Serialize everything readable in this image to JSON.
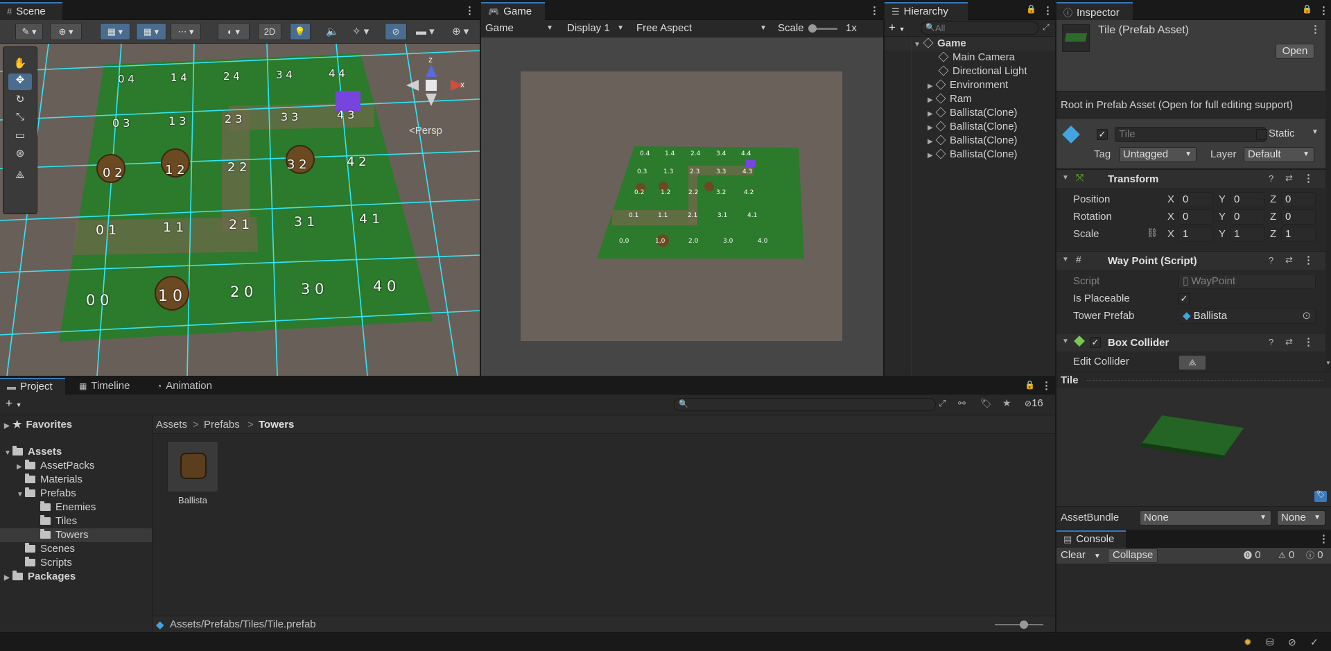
{
  "scene": {
    "tab": "Scene",
    "btn_2d": "2D",
    "persp_label": "Persp",
    "axis_x": "x",
    "axis_z": "z",
    "grid_labels": [
      "0 4",
      "1 4",
      "2 4",
      "3 4",
      "4 4",
      "0 3",
      "1 3",
      "2 3",
      "3 3",
      "4 3",
      "0 2",
      "1 2",
      "2 2",
      "3 2",
      "4 2",
      "0 1",
      "1 1",
      "2 1",
      "3 1",
      "4 1",
      "0 0",
      "1 0",
      "2 0",
      "3 0",
      "4 0"
    ]
  },
  "game": {
    "tab": "Game",
    "mode": "Game",
    "display": "Display 1",
    "aspect": "Free Aspect",
    "scale_label": "Scale",
    "scale_value": "1x",
    "grid_labels": [
      "0.4",
      "1.4",
      "2.4",
      "3.4",
      "4.4",
      "0.3",
      "1.3",
      "2.3",
      "3.3",
      "4.3",
      "0.2",
      "1.2",
      "2.2",
      "3.2",
      "4.2",
      "0.1",
      "1.1",
      "2.1",
      "3.1",
      "4.1",
      "0,0",
      "1,0",
      "2.0",
      "3.0",
      "4.0"
    ]
  },
  "hierarchy": {
    "tab": "Hierarchy",
    "search_placeholder": "All",
    "root": "Game",
    "items": [
      "Main Camera",
      "Directional Light",
      "Environment",
      "Ram",
      "Ballista(Clone)",
      "Ballista(Clone)",
      "Ballista(Clone)",
      "Ballista(Clone)"
    ]
  },
  "inspector": {
    "tab": "Inspector",
    "asset_title": "Tile (Prefab Asset)",
    "open_button": "Open",
    "root_note": "Root in Prefab Asset (Open for full editing support)",
    "object_name": "Tile",
    "static_label": "Static",
    "tag_label": "Tag",
    "tag_value": "Untagged",
    "layer_label": "Layer",
    "layer_value": "Default",
    "transform": {
      "title": "Transform",
      "position_label": "Position",
      "rotation_label": "Rotation",
      "scale_label": "Scale",
      "x": "X",
      "y": "Y",
      "z": "Z",
      "position": [
        "0",
        "0",
        "0"
      ],
      "rotation": [
        "0",
        "0",
        "0"
      ],
      "scale": [
        "1",
        "1",
        "1"
      ]
    },
    "waypoint": {
      "title": "Way Point (Script)",
      "script_label": "Script",
      "script_value": "WayPoint",
      "placeable_label": "Is Placeable",
      "tower_label": "Tower Prefab",
      "tower_value": "Ballista"
    },
    "box_collider": {
      "title": "Box Collider",
      "edit_label": "Edit Collider"
    },
    "preview_title": "Tile",
    "assetbundle_label": "AssetBundle",
    "assetbundle_value": "None",
    "assetbundle_variant": "None"
  },
  "project": {
    "tabs": [
      "Project",
      "Timeline",
      "Animation"
    ],
    "hidden_count": "16",
    "tree": {
      "favorites": "Favorites",
      "assets": "Assets",
      "assetpacks": "AssetPacks",
      "materials": "Materials",
      "prefabs": "Prefabs",
      "enemies": "Enemies",
      "tiles": "Tiles",
      "towers": "Towers",
      "scenes": "Scenes",
      "scripts": "Scripts",
      "packages": "Packages"
    },
    "breadcrumb": [
      "Assets",
      "Prefabs",
      "Towers"
    ],
    "asset_item": "Ballista",
    "footer_path": "Assets/Prefabs/Tiles/Tile.prefab"
  },
  "console": {
    "tab": "Console",
    "clear": "Clear",
    "collapse": "Collapse",
    "errors": "0",
    "warnings": "0",
    "infos": "0"
  }
}
